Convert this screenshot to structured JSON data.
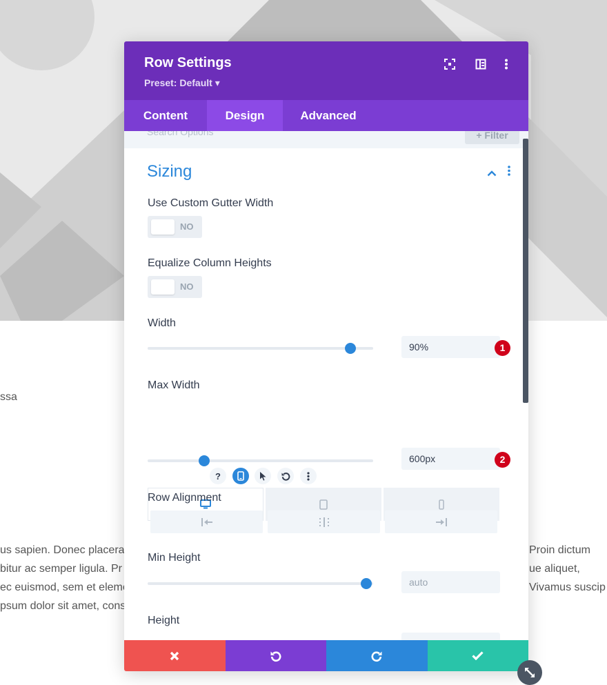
{
  "background": {
    "text_left": "ssa",
    "paragraph_left": [
      "us sapien. Donec placera",
      "bitur ac semper ligula. Pr",
      "ec euismod, sem et eleme",
      "psum dolor sit amet, cons"
    ],
    "paragraph_right": [
      "Proin dictum",
      "ue aliquet,",
      "Vivamus suscip"
    ]
  },
  "modal": {
    "title": "Row Settings",
    "preset": "Preset: Default ▾",
    "tabs": [
      {
        "label": "Content"
      },
      {
        "label": "Design"
      },
      {
        "label": "Advanced"
      }
    ],
    "active_tab": "Design",
    "search_placeholder": "Search Options",
    "filter_label": "+ Filter",
    "section_title": "Sizing",
    "fields": {
      "gutter": {
        "label": "Use Custom Gutter Width",
        "value": "NO"
      },
      "equalize": {
        "label": "Equalize Column Heights",
        "value": "NO"
      },
      "width": {
        "label": "Width",
        "value": "90%",
        "badge": "1",
        "slider_fraction": 0.9
      },
      "max_width": {
        "label": "Max Width",
        "help": "?",
        "value": "600px",
        "badge": "2",
        "slider_fraction": 0.25
      },
      "row_alignment": {
        "label": "Row Alignment"
      },
      "min_height": {
        "label": "Min Height",
        "value": "auto",
        "slider_fraction": 0.97
      },
      "height": {
        "label": "Height"
      }
    }
  },
  "colors": {
    "header": "#6c2eb9",
    "tabs": "#7b3dd3",
    "active_tab": "#8c4ae6",
    "accent": "#2b87da",
    "cancel": "#ef5350",
    "undo": "#7b3dd3",
    "redo": "#2b87da",
    "save": "#29c4a9",
    "badge": "#d0021b"
  },
  "icons": {
    "header": [
      "fullscreen-icon",
      "split-view-icon",
      "more-icon"
    ],
    "max_width_tools": [
      "help-icon",
      "responsive-icon",
      "hover-cursor-icon",
      "reset-icon",
      "more-icon"
    ],
    "devices": [
      "desktop-icon",
      "tablet-icon",
      "phone-icon"
    ],
    "alignment": [
      "align-left-icon",
      "align-center-icon",
      "align-right-icon"
    ],
    "footer": [
      "close-icon",
      "undo-icon",
      "redo-icon",
      "check-icon"
    ]
  }
}
